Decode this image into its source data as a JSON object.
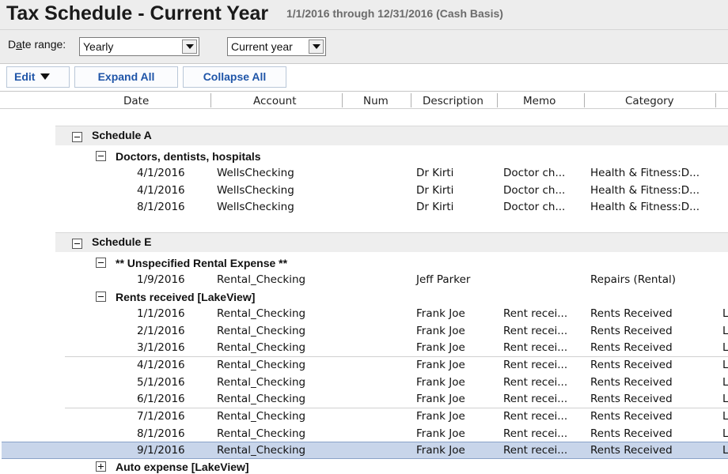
{
  "header": {
    "title": "Tax Schedule - Current Year",
    "subtitle": "1/1/2016 through 12/31/2016 (Cash Basis)"
  },
  "filter": {
    "date_range_label_accel": "a",
    "date_range_label_rest": "te range:",
    "date_range_label_first": "D",
    "range_value": "Yearly",
    "period_value": "Current year"
  },
  "toolbar": {
    "edit_label": "Edit",
    "expand_label": "Expand All",
    "collapse_label": "Collapse All"
  },
  "columns": [
    "Date",
    "Account",
    "Num",
    "Description",
    "Memo",
    "Category"
  ],
  "schedules": [
    {
      "label": "Schedule A",
      "expanded": true
    },
    {
      "label": "Schedule E",
      "expanded": true
    }
  ],
  "groups": [
    {
      "label": "Doctors, dentists, hospitals",
      "expanded": true
    },
    {
      "label": "** Unspecified Rental Expense **",
      "expanded": true
    },
    {
      "label": "Rents received [LakeView]",
      "expanded": true
    },
    {
      "label": "Auto expense [LakeView]",
      "expanded": false
    }
  ],
  "rows": [
    {
      "date": "4/1/2016",
      "account": "WellsChecking",
      "num": "",
      "description": "Dr Kirti",
      "memo": "Doctor ch...",
      "category": "Health & Fitness:D...",
      "extra": ""
    },
    {
      "date": "4/1/2016",
      "account": "WellsChecking",
      "num": "",
      "description": "Dr Kirti",
      "memo": "Doctor ch...",
      "category": "Health & Fitness:D...",
      "extra": ""
    },
    {
      "date": "8/1/2016",
      "account": "WellsChecking",
      "num": "",
      "description": "Dr Kirti",
      "memo": "Doctor ch...",
      "category": "Health & Fitness:D...",
      "extra": ""
    },
    {
      "date": "1/9/2016",
      "account": "Rental_Checking",
      "num": "",
      "description": "Jeff Parker",
      "memo": "",
      "category": "Repairs (Rental)",
      "extra": ""
    },
    {
      "date": "1/1/2016",
      "account": "Rental_Checking",
      "num": "",
      "description": "Frank Joe",
      "memo": "Rent recei...",
      "category": "Rents Received",
      "extra": "L"
    },
    {
      "date": "2/1/2016",
      "account": "Rental_Checking",
      "num": "",
      "description": "Frank Joe",
      "memo": "Rent recei...",
      "category": "Rents Received",
      "extra": "L"
    },
    {
      "date": "3/1/2016",
      "account": "Rental_Checking",
      "num": "",
      "description": "Frank Joe",
      "memo": "Rent recei...",
      "category": "Rents Received",
      "extra": "L"
    },
    {
      "date": "4/1/2016",
      "account": "Rental_Checking",
      "num": "",
      "description": "Frank Joe",
      "memo": "Rent recei...",
      "category": "Rents Received",
      "extra": "L"
    },
    {
      "date": "5/1/2016",
      "account": "Rental_Checking",
      "num": "",
      "description": "Frank Joe",
      "memo": "Rent recei...",
      "category": "Rents Received",
      "extra": "L"
    },
    {
      "date": "6/1/2016",
      "account": "Rental_Checking",
      "num": "",
      "description": "Frank Joe",
      "memo": "Rent recei...",
      "category": "Rents Received",
      "extra": "L"
    },
    {
      "date": "7/1/2016",
      "account": "Rental_Checking",
      "num": "",
      "description": "Frank Joe",
      "memo": "Rent recei...",
      "category": "Rents Received",
      "extra": "L"
    },
    {
      "date": "8/1/2016",
      "account": "Rental_Checking",
      "num": "",
      "description": "Frank Joe",
      "memo": "Rent recei...",
      "category": "Rents Received",
      "extra": "L"
    },
    {
      "date": "9/1/2016",
      "account": "Rental_Checking",
      "num": "",
      "description": "Frank Joe",
      "memo": "Rent recei...",
      "category": "Rents Received",
      "extra": "L",
      "selected": true
    }
  ]
}
